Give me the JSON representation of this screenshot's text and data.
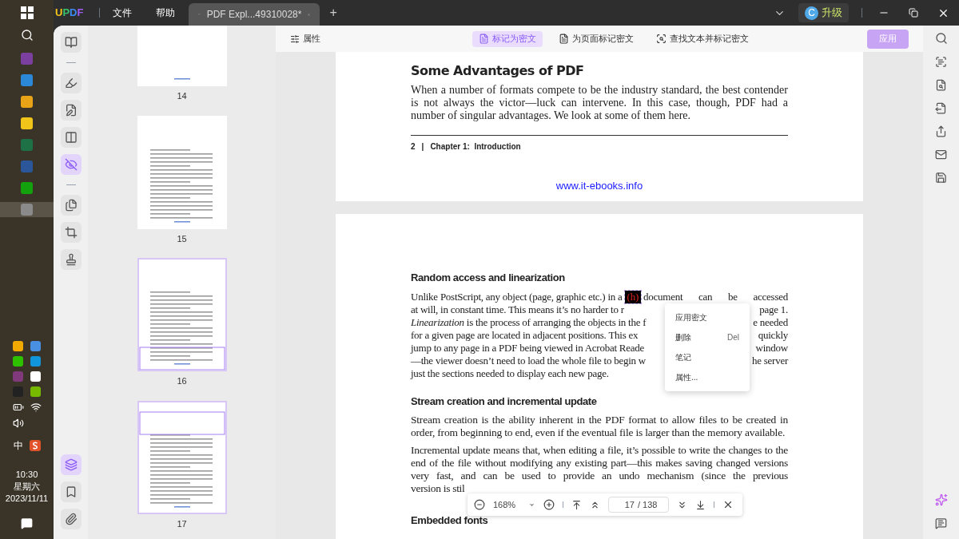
{
  "taskbar": {
    "apps": [
      {
        "color": "#7b3fa0",
        "selected": false
      },
      {
        "color": "#2b88d8",
        "selected": false
      },
      {
        "color": "#e8a317",
        "selected": false
      },
      {
        "color": "#f0c419",
        "selected": false
      },
      {
        "color": "#1e7145",
        "selected": false
      },
      {
        "color": "#2b579a",
        "selected": false
      },
      {
        "color": "#13a10e",
        "selected": false
      },
      {
        "color": "#8a8a8a",
        "selected": true
      }
    ],
    "tray": [
      {
        "color": "#f2a900"
      },
      {
        "color": "#4a90e2"
      },
      {
        "color": "#2dc100"
      },
      {
        "color": "#1296db"
      },
      {
        "color": "#80397b"
      },
      {
        "color": "#ffffff"
      },
      {
        "color": "#222222"
      },
      {
        "color": "#76b900"
      }
    ],
    "ime": "中",
    "clock": {
      "time": "10:30",
      "weekday": "星期六",
      "date": "2023/11/11"
    }
  },
  "titlebar": {
    "logo": "UPDF",
    "menus": [
      "文件",
      "帮助"
    ],
    "tab": {
      "title": "PDF Expl...49310028*"
    },
    "new_tab": "+",
    "account": {
      "initial": "C",
      "label": "升级"
    }
  },
  "toolbar": {
    "properties": "属性",
    "modes": [
      {
        "label": "标记为密文",
        "selected": true
      },
      {
        "label": "为页面标记密文",
        "selected": false
      },
      {
        "label": "查找文本并标记密文",
        "selected": false
      }
    ],
    "apply": {
      "label": "应用",
      "disabled": true
    }
  },
  "left_tools": [
    {
      "kind": "reader",
      "selected": false
    },
    {
      "kind": "divider"
    },
    {
      "kind": "highlight",
      "selected": false
    },
    {
      "kind": "edit",
      "selected": false
    },
    {
      "kind": "form",
      "selected": false
    },
    {
      "kind": "redact",
      "selected": true
    },
    {
      "kind": "divider"
    },
    {
      "kind": "organize",
      "selected": false
    },
    {
      "kind": "crop",
      "selected": false
    },
    {
      "kind": "watermark",
      "selected": false
    }
  ],
  "left_bottom": [
    {
      "kind": "layers",
      "selected": true
    },
    {
      "kind": "bookmark",
      "selected": false
    },
    {
      "kind": "attachment",
      "selected": false
    }
  ],
  "thumbnails": [
    {
      "label": "14",
      "in_view": false,
      "partial": true
    },
    {
      "label": "15",
      "in_view": false,
      "partial": false
    },
    {
      "label": "16",
      "in_view": true,
      "partial": false
    },
    {
      "label": "17",
      "in_view": true,
      "partial": false
    }
  ],
  "page_1": {
    "heading": "Some Advantages of PDF",
    "paragraph": "When a number of formats compete to be the industry standard, the best contender is not always the victor—luck can intervene. In this case, though, PDF had a number of singular advantages. We look at some of them here.",
    "footer": {
      "number": "2",
      "separator": "|",
      "chapter": "Chapter 1:  Introduction"
    },
    "link": "www.it-ebooks.info"
  },
  "page_2": {
    "heading_1": "Random access and linearization",
    "lines": [
      {
        "left": "Unlike PostScript, any object (page, graphic etc.) in a",
        "redacted": "(h)",
        "right": "document can be accessed"
      },
      {
        "left": "at will, in constant time. This means it’s no harder to r",
        "right": "page 1."
      },
      {
        "left": "*Linearization* is the process of arranging the objects in the f",
        "right": "e needed"
      },
      {
        "left": "for a given page are located in adjacent positions. This ex",
        "right": "quickly"
      },
      {
        "left": "jump to any page in a PDF being viewed in Acrobat Reade",
        "right": "window"
      },
      {
        "left": "—the viewer doesn’t need to load the whole file to begin w",
        "right": "he server"
      },
      {
        "left": "just the sections needed to display each new page."
      }
    ],
    "heading_2": "Stream creation and incremental update",
    "paragraphs": [
      "Stream creation is the ability inherent in the PDF format to allow files to be created in order, from beginning to end, even if the eventual file is larger than the memory available."
    ],
    "last_paragraph": {
      "text": "Incremental update means that, when editing a file, it’s possible to write the changes to the end of the file without modifying any existing part—this makes saving changed versions very fast, and can be used to provide an undo mechanism (since the previous",
      "cut_line": "version is stil"
    },
    "heading_3": "Embedded fonts"
  },
  "context_menu": [
    {
      "label": "应用密文"
    },
    {
      "label": "删除",
      "shortcut": "Del"
    },
    {
      "label": "笔记"
    },
    {
      "label": "属性..."
    }
  ],
  "zoom_bar": {
    "zoom": "168%",
    "page": "17",
    "total": "/ 138"
  }
}
